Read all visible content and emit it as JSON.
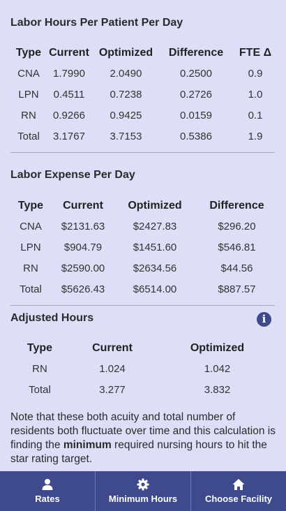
{
  "labor_hours": {
    "title": "Labor Hours Per Patient Per Day",
    "headers": [
      "Type",
      "Current",
      "Optimized",
      "Difference",
      "FTE Δ"
    ],
    "rows": [
      [
        "CNA",
        "1.7990",
        "2.0490",
        "0.2500",
        "0.9"
      ],
      [
        "LPN",
        "0.4511",
        "0.7238",
        "0.2726",
        "1.0"
      ],
      [
        "RN",
        "0.9266",
        "0.9425",
        "0.0159",
        "0.1"
      ],
      [
        "Total",
        "3.1767",
        "3.7153",
        "0.5386",
        "1.9"
      ]
    ]
  },
  "labor_expense": {
    "title": "Labor Expense Per Day",
    "headers": [
      "Type",
      "Current",
      "Optimized",
      "Difference"
    ],
    "rows": [
      [
        "CNA",
        "$2131.63",
        "$2427.83",
        "$296.20"
      ],
      [
        "LPN",
        "$904.79",
        "$1451.60",
        "$546.81"
      ],
      [
        "RN",
        "$2590.00",
        "$2634.56",
        "$44.56"
      ],
      [
        "Total",
        "$5626.43",
        "$6514.00",
        "$887.57"
      ]
    ]
  },
  "adjusted_hours": {
    "title": "Adjusted Hours",
    "info_icon": "i",
    "headers": [
      "Type",
      "Current",
      "Optimized"
    ],
    "rows": [
      [
        "RN",
        "1.024",
        "1.042"
      ],
      [
        "Total",
        "3.277",
        "3.832"
      ]
    ]
  },
  "note": {
    "before": "Note that these both acuity and total number of residents both fluctuate over time and this calculation is finding the ",
    "emphasis": "minimum",
    "after": " required nursing hours to hit the star rating target."
  },
  "navbar": {
    "items": [
      {
        "label": "Rates",
        "icon": "person-icon"
      },
      {
        "label": "Minimum Hours",
        "icon": "gear-icon"
      },
      {
        "label": "Choose Facility",
        "icon": "home-icon"
      }
    ]
  },
  "colors": {
    "background": "#dcdff7",
    "navbar": "#3f4a8c",
    "info_icon": "#3d4a8c"
  }
}
